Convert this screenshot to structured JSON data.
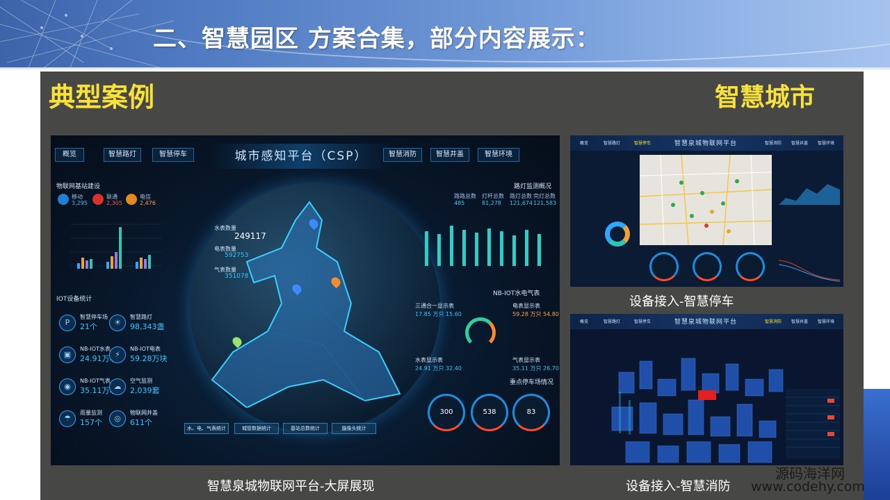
{
  "header": {
    "title": "二、智慧园区 方案合集，部分内容展示："
  },
  "panel": {
    "label_left": "典型案例",
    "label_right": "智慧城市",
    "caption_main": "智慧泉城物联网平台-大屏展现",
    "caption_parking": "设备接入-智慧停车",
    "caption_fire": "设备接入-智慧消防"
  },
  "big_screen": {
    "tabs_left": [
      "概览",
      "智慧路灯",
      "智慧停车"
    ],
    "title": "城市感知平台（CSP）",
    "tabs_right": [
      "智慧消防",
      "智慧井盖",
      "智慧环境"
    ],
    "iot_base_header": "物联网基站建设",
    "carriers": [
      {
        "name": "移动",
        "value": "3,295"
      },
      {
        "name": "联通",
        "value": "2,305"
      },
      {
        "name": "电信",
        "value": "2,476"
      }
    ],
    "iot_device_header": "IOT设备统计",
    "iot_devices": [
      {
        "name": "智慧停车场",
        "value": "21个",
        "icon": "P"
      },
      {
        "name": "智慧路灯",
        "value": "98,343盏",
        "icon": "☀"
      },
      {
        "name": "NB-IOT水表",
        "value": "24.91万块",
        "icon": "▣"
      },
      {
        "name": "NB-IOT电表",
        "value": "59.28万块",
        "icon": "⚡"
      },
      {
        "name": "NB-IOT气表",
        "value": "35.11万块",
        "icon": "◉"
      },
      {
        "name": "空气监测",
        "value": "2,039套",
        "icon": "☁"
      },
      {
        "name": "雨量监测",
        "value": "157个",
        "icon": "☂"
      },
      {
        "name": "物联网井盖",
        "value": "611个",
        "icon": "◎"
      }
    ],
    "globe_labels": [
      {
        "name": "水表数量",
        "value": "249117"
      },
      {
        "name": "电表数量",
        "value": "592753"
      },
      {
        "name": "气表数量",
        "value": "351078"
      }
    ],
    "street_light_header": "路灯监测概况",
    "street_light_stats": [
      {
        "name": "路路总数",
        "value": "485"
      },
      {
        "name": "灯杆总数",
        "value": "81,278"
      },
      {
        "name": "路灯总数",
        "value": "121,674"
      },
      {
        "name": "完灯总数",
        "value": "121,583"
      }
    ],
    "nb_header": "NB-IOT水电气表",
    "nb_water": {
      "name": "三通合一显示表",
      "value": "17.85 万只 15.60"
    },
    "nb_power": {
      "name": "电表显示表",
      "value": "59.28 万只 54.80"
    },
    "nb_water2": {
      "name": "水表显示表",
      "value": "24.91 万只 32.40"
    },
    "nb_gas": {
      "name": "气表显示表",
      "value": "35.11 万只 26.70"
    },
    "parking_header": "重点停车场情况",
    "gauges": [
      "300",
      "538",
      "83"
    ],
    "bottom_tabs": [
      "水、电、气表统计",
      "城管数据统计",
      "基站总数统计",
      "摄像头统计"
    ]
  },
  "parking_screen": {
    "tabs_left": [
      "概览",
      "智慧路灯",
      "智慧停车"
    ],
    "title": "智慧泉城物联网平台",
    "tabs_right": [
      "智慧消防",
      "智慧井盖",
      "智慧环境"
    ]
  },
  "fire_screen": {
    "tabs_left": [
      "概览",
      "智慧路灯",
      "智慧停车"
    ],
    "title": "智慧泉城物联网平台",
    "tabs_right": [
      "智慧消防",
      "智慧井盖",
      "智慧环境"
    ]
  },
  "watermark": {
    "line1": "源码海洋网",
    "line2": "www.codehy.com"
  }
}
